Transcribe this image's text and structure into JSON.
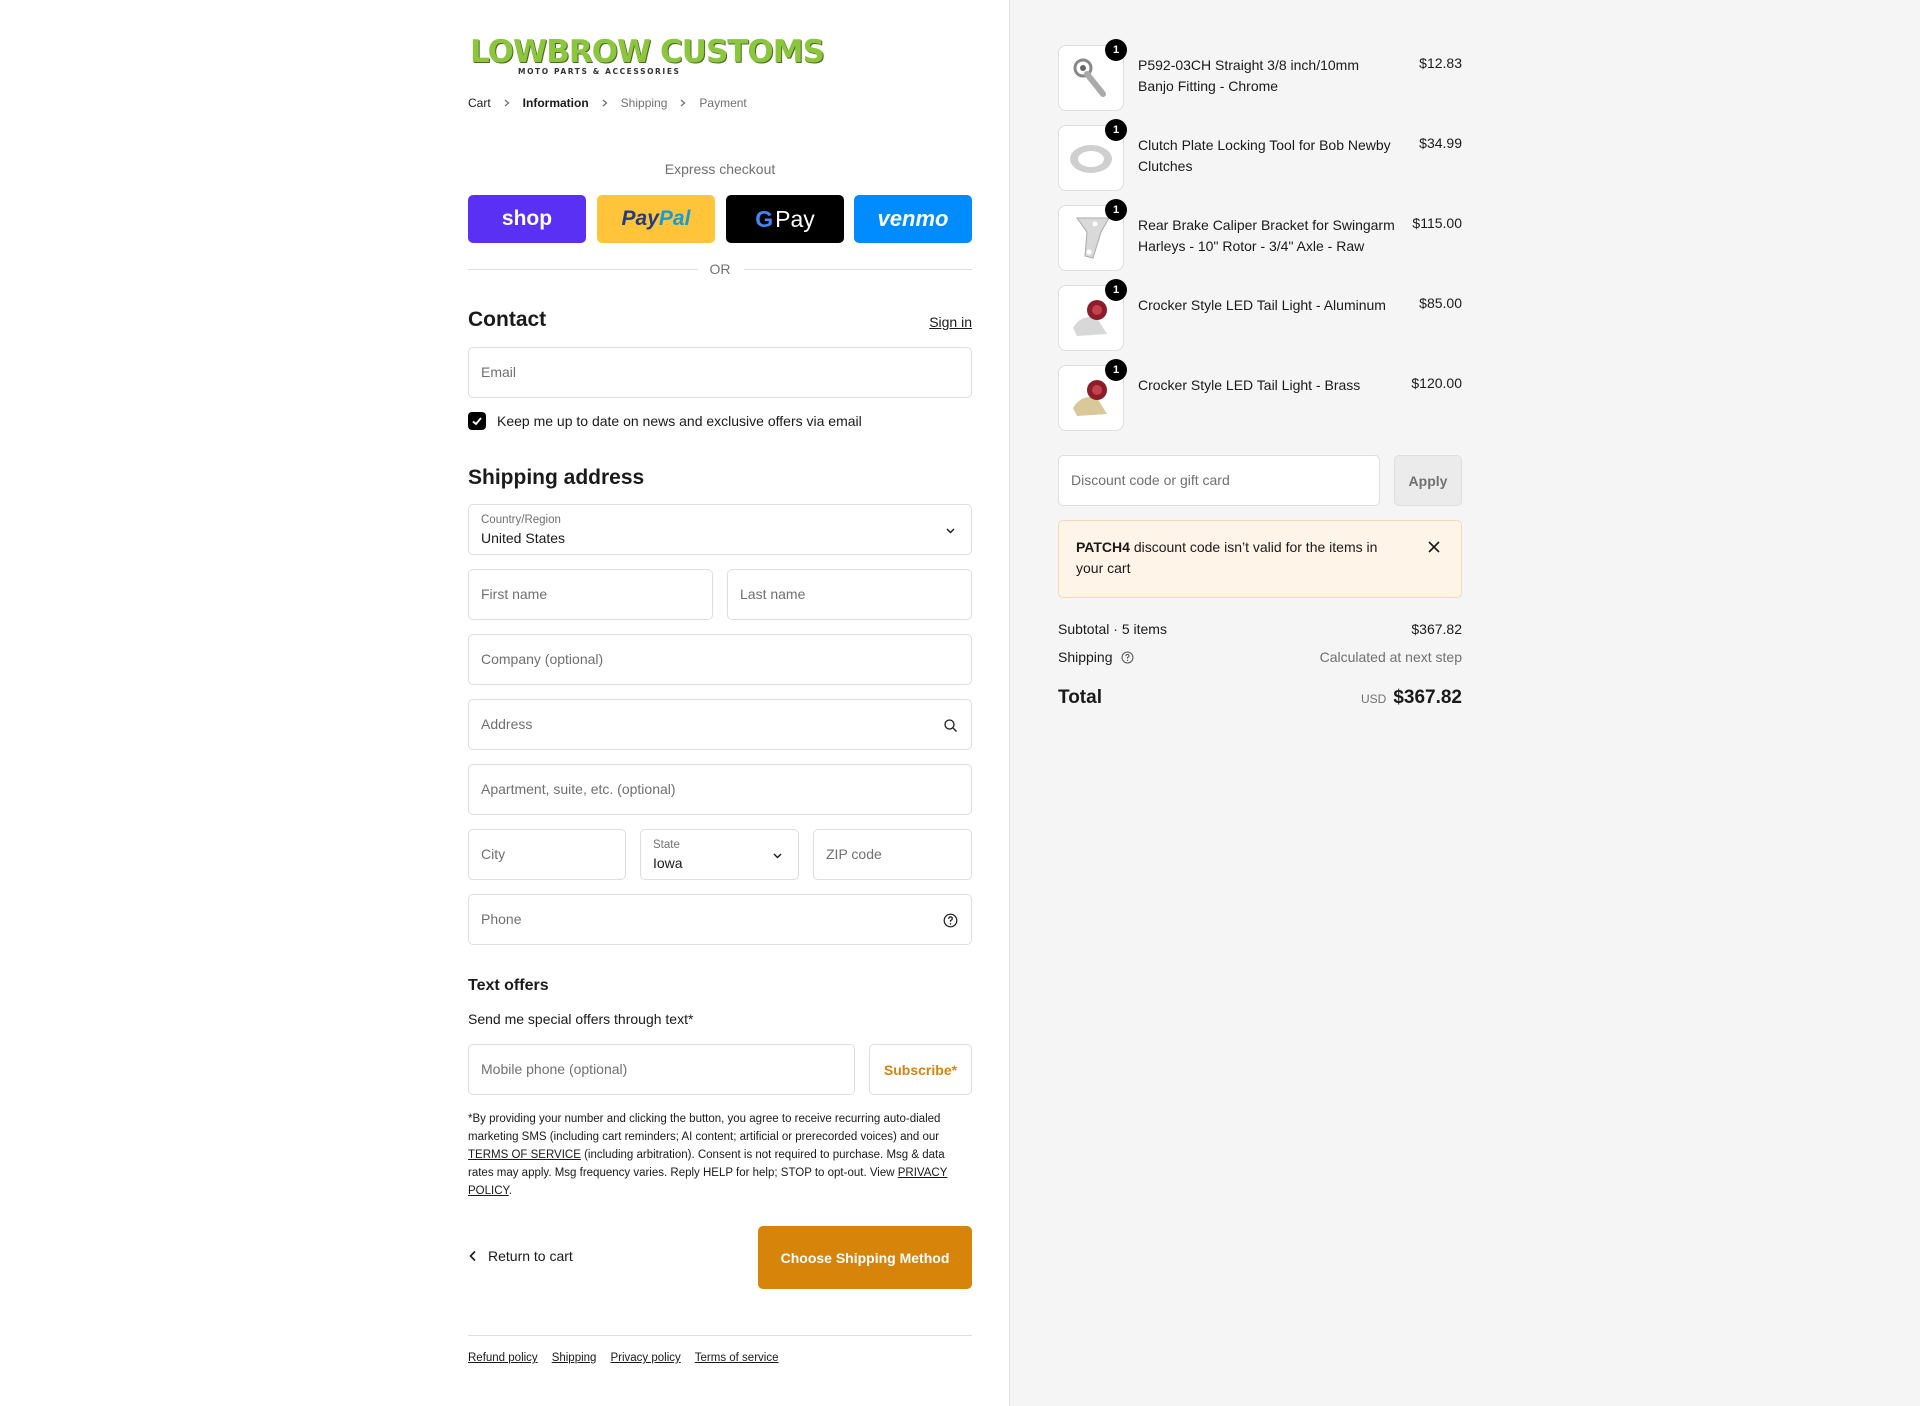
{
  "brand": {
    "name": "LOWBROW CUSTOMS",
    "tagline": "MOTO PARTS & ACCESSORIES",
    "accent_color": "#d6850a",
    "logo_color": "#8cc63f"
  },
  "breadcrumb": {
    "cart": "Cart",
    "information": "Information",
    "shipping": "Shipping",
    "payment": "Payment"
  },
  "express": {
    "label": "Express checkout",
    "shop": "shop",
    "paypal_1": "Pay",
    "paypal_2": "Pal",
    "gpay_g": "G",
    "gpay": "Pay",
    "venmo": "venmo",
    "or": "OR"
  },
  "contact": {
    "heading": "Contact",
    "sign_in": "Sign in",
    "email_placeholder": "Email",
    "newsletter_label": "Keep me up to date on news and exclusive offers via email",
    "newsletter_checked": true
  },
  "shipping": {
    "heading": "Shipping address",
    "country_label": "Country/Region",
    "country_value": "United States",
    "first_name": "First name",
    "last_name": "Last name",
    "company": "Company (optional)",
    "address": "Address",
    "apartment": "Apartment, suite, etc. (optional)",
    "city": "City",
    "state_label": "State",
    "state_value": "Iowa",
    "zip": "ZIP code",
    "phone": "Phone"
  },
  "text_offers": {
    "heading": "Text offers",
    "subheading": "Send me special offers through text*",
    "mobile_placeholder": "Mobile phone (optional)",
    "subscribe": "Subscribe*",
    "disclaimer_1": "*By providing your number and clicking the button, you agree to receive recurring auto-dialed marketing SMS (including cart reminders; AI content; artificial or prerecorded voices) and our ",
    "terms_link": "TERMS OF SERVICE",
    "disclaimer_2": " (including arbitration). Consent is not required to purchase. Msg & data rates may apply. Msg frequency varies. Reply HELP for help; STOP to opt-out. View ",
    "privacy_link": "PRIVACY POLICY",
    "disclaimer_3": "."
  },
  "actions": {
    "return": "Return to cart",
    "continue": "Choose Shipping Method"
  },
  "footer": {
    "refund": "Refund policy",
    "shipping": "Shipping",
    "privacy": "Privacy policy",
    "terms": "Terms of service"
  },
  "cart": {
    "items": [
      {
        "name": "P592-03CH Straight 3/8 inch/10mm Banjo Fitting - Chrome",
        "price": "$12.83",
        "qty": "1",
        "icon": "banjo-fitting-icon"
      },
      {
        "name": "Clutch Plate Locking Tool for Bob Newby Clutches",
        "price": "$34.99",
        "qty": "1",
        "icon": "clutch-plate-icon"
      },
      {
        "name": "Rear Brake Caliper Bracket for Swingarm Harleys - 10\" Rotor - 3/4\" Axle - Raw",
        "price": "$115.00",
        "qty": "1",
        "icon": "bracket-icon"
      },
      {
        "name": "Crocker Style LED Tail Light - Aluminum",
        "price": "$85.00",
        "qty": "1",
        "icon": "tail-light-icon"
      },
      {
        "name": "Crocker Style LED Tail Light - Brass",
        "price": "$120.00",
        "qty": "1",
        "icon": "tail-light-icon"
      }
    ],
    "discount_placeholder": "Discount code or gift card",
    "apply": "Apply",
    "notice_code": "PATCH4",
    "notice_text": " discount code isn’t valid for the items in your cart",
    "subtotal_label": "Subtotal · 5 items",
    "subtotal": "$367.82",
    "shipping_label": "Shipping",
    "shipping_value": "Calculated at next step",
    "total_label": "Total",
    "currency": "USD",
    "total": "$367.82"
  }
}
